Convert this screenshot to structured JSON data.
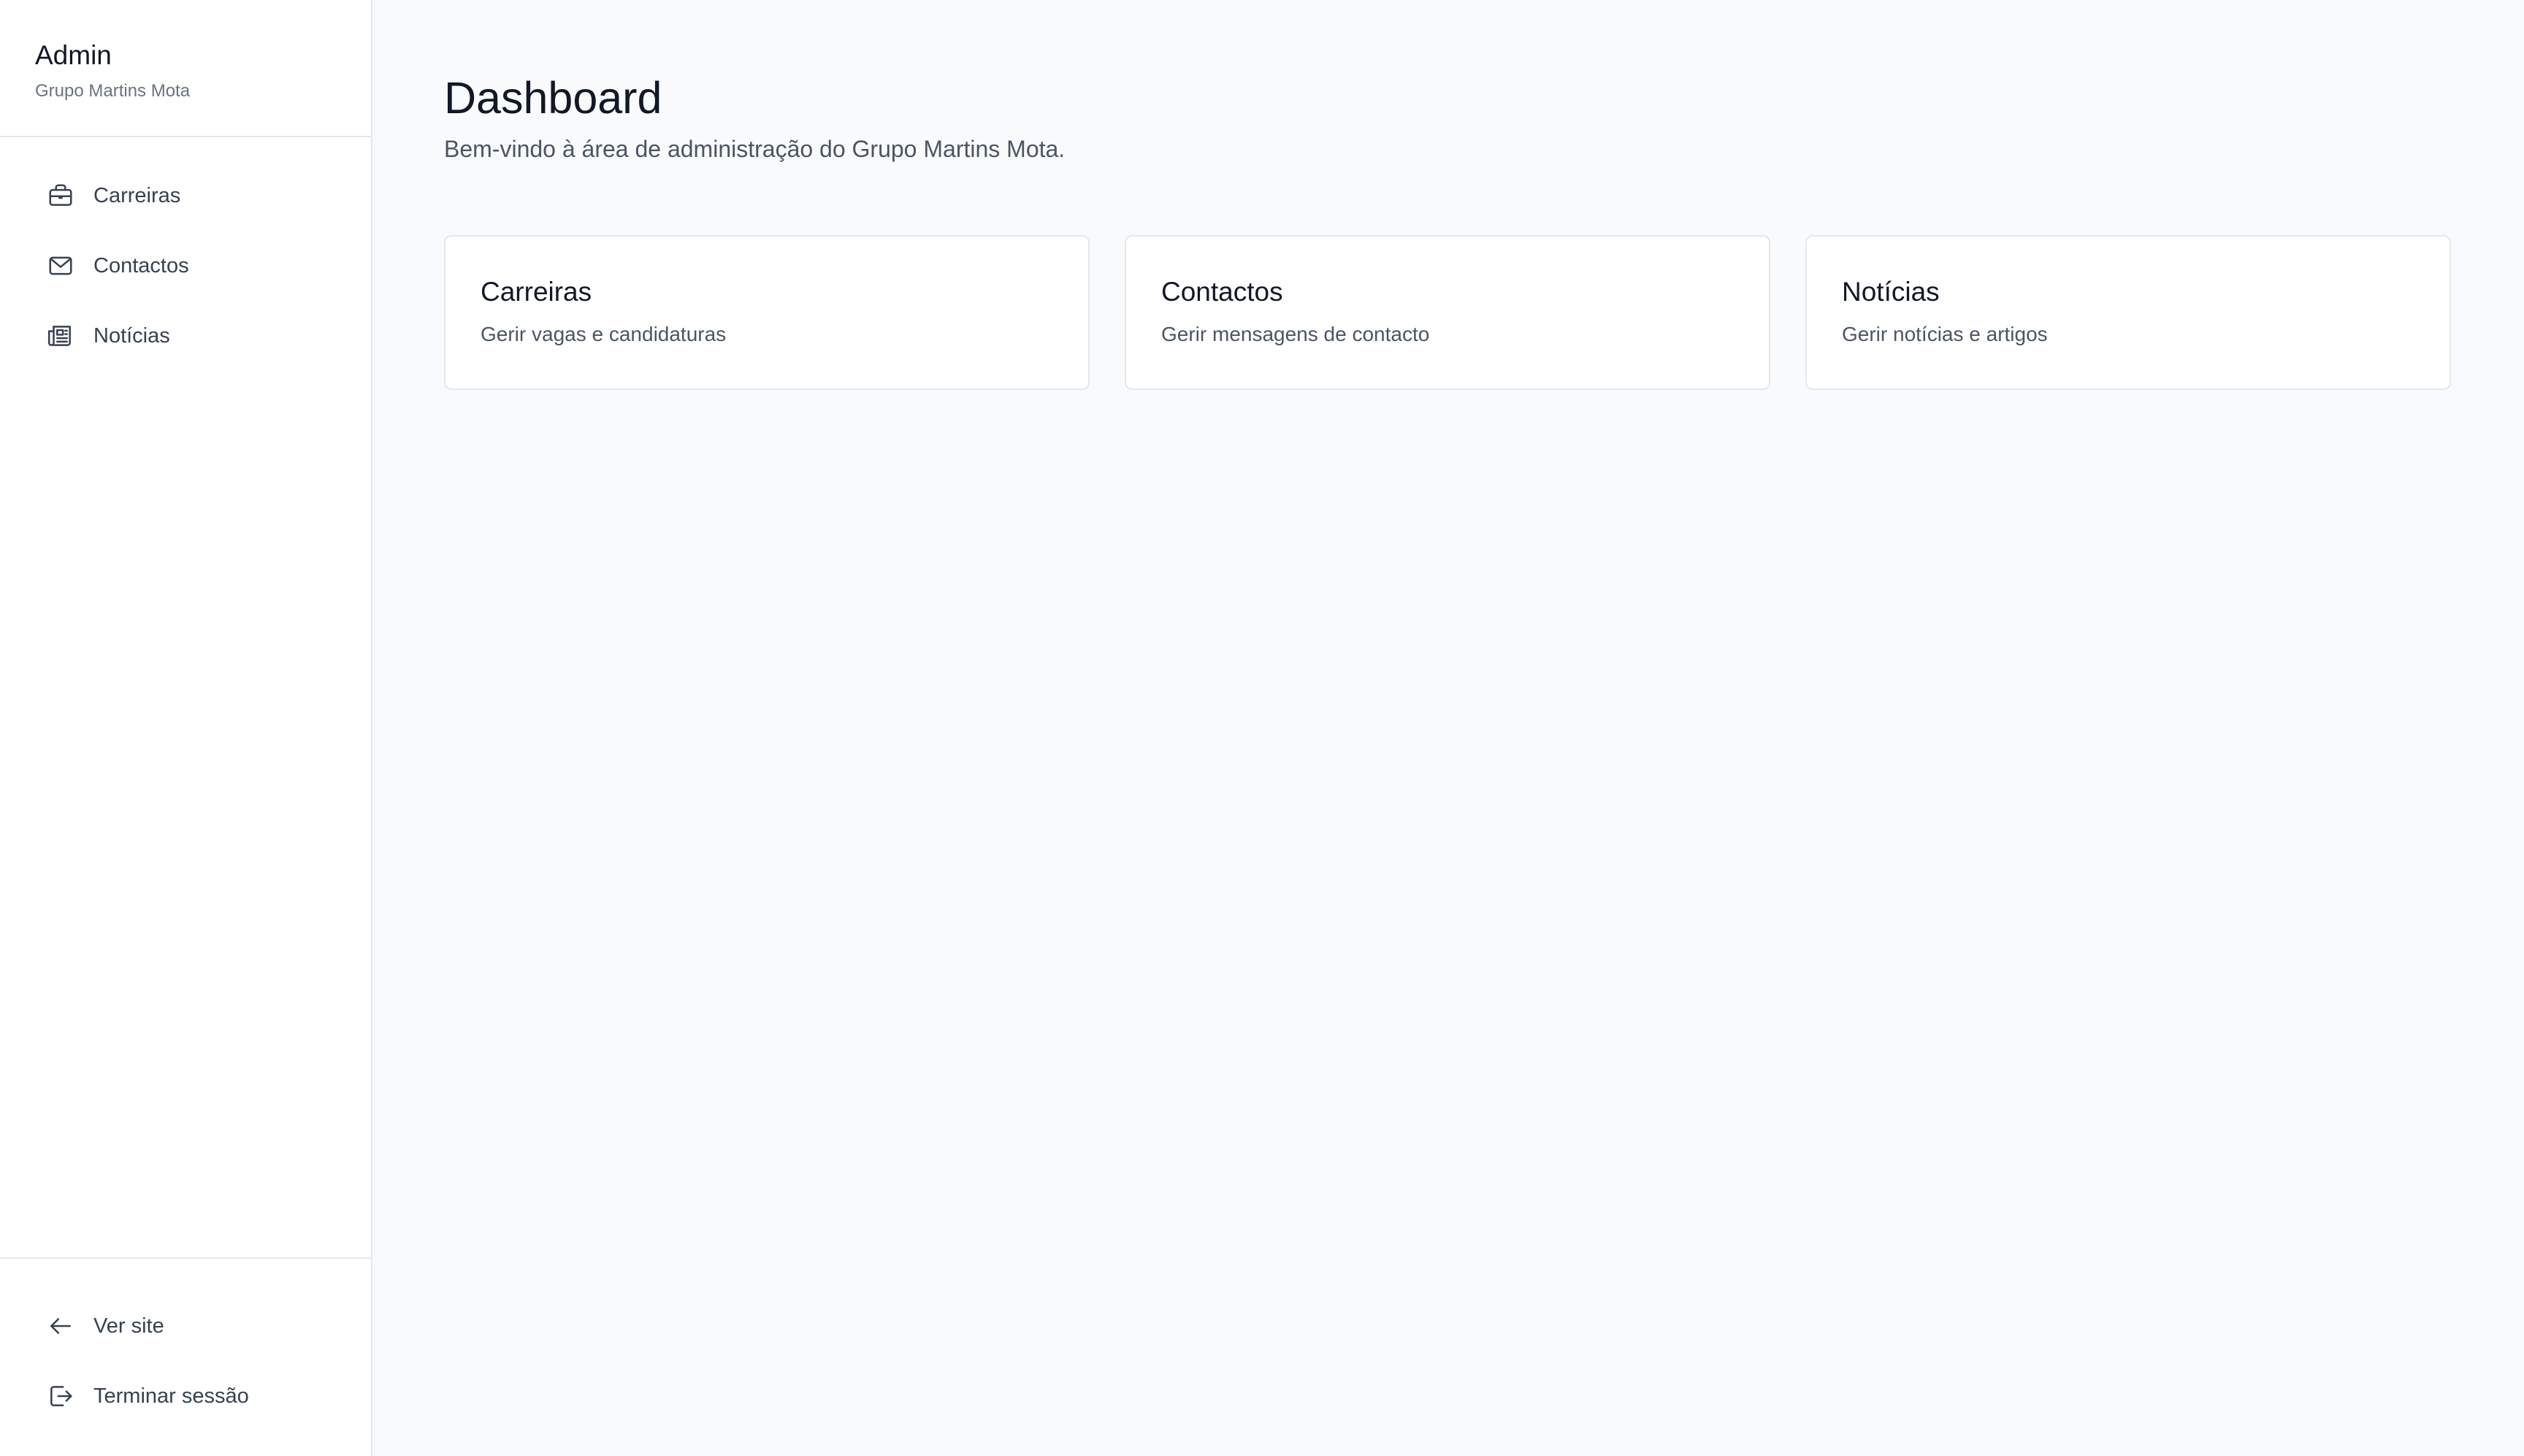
{
  "sidebar": {
    "brand_title": "Admin",
    "brand_subtitle": "Grupo Martins Mota",
    "nav": [
      {
        "label": "Carreiras",
        "icon": "briefcase-icon"
      },
      {
        "label": "Contactos",
        "icon": "mail-icon"
      },
      {
        "label": "Notícias",
        "icon": "newspaper-icon"
      }
    ],
    "footer": [
      {
        "label": "Ver site",
        "icon": "arrow-left-icon"
      },
      {
        "label": "Terminar sessão",
        "icon": "logout-icon"
      }
    ]
  },
  "main": {
    "title": "Dashboard",
    "subtitle": "Bem-vindo à área de administração do Grupo Martins Mota.",
    "cards": [
      {
        "title": "Carreiras",
        "description": "Gerir vagas e candidaturas"
      },
      {
        "title": "Contactos",
        "description": "Gerir mensagens de contacto"
      },
      {
        "title": "Notícias",
        "description": "Gerir notícias e artigos"
      }
    ]
  },
  "colors": {
    "background": "#f9fafb",
    "panel": "#ffffff",
    "border": "#e5e7eb",
    "text_primary": "#111827",
    "text_secondary": "#4b5563",
    "text_muted": "#6b7280"
  }
}
